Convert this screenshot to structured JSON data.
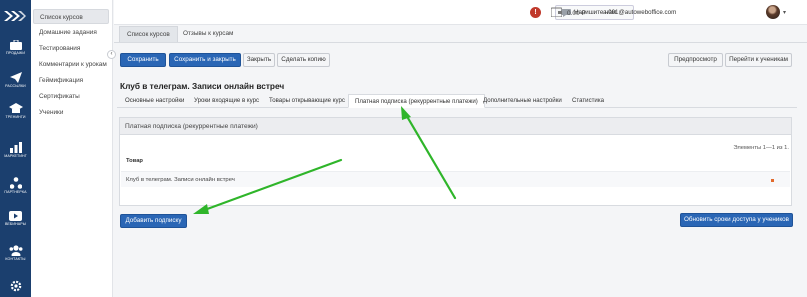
{
  "rail": {
    "items": [
      {
        "label": "ПРОДАЖИ",
        "icon": "briefcase-icon"
      },
      {
        "label": "РАССЫЛКИ",
        "icon": "paper-plane-icon"
      },
      {
        "label": "ТРЕНИНГИ",
        "icon": "graduation-cap-icon"
      },
      {
        "label": "МАРКЕТИНГ",
        "icon": "bar-chart-icon"
      },
      {
        "label": "ПАРТНЕРКА",
        "icon": "network-icon"
      },
      {
        "label": "ВЕБИНАРЫ",
        "icon": "video-play-icon"
      },
      {
        "label": "КОНТАКТЫ",
        "icon": "users-icon"
      },
      {
        "label": "",
        "icon": "gear-icon"
      }
    ]
  },
  "submenu": {
    "items": [
      "Список курсов",
      "Домашние задания",
      "Тестирования",
      "Комментарии к урокам",
      "Геймификация",
      "Сертификаты",
      "Ученики"
    ]
  },
  "header": {
    "write_us": "Напишите нам",
    "alert": "!",
    "balance": "0.00 ₽",
    "email": "a.001@autowebоffice.com",
    "caret": "▾"
  },
  "module_tabs": [
    "Список курсов",
    "Отзывы к курсам"
  ],
  "toolbar": {
    "save": "Сохранить",
    "save_close": "Сохранить и закрыть",
    "close": "Закрыть",
    "copy": "Сделать копию",
    "preview": "Предпросмотр",
    "go_students": "Перейти к ученикам"
  },
  "page_title": "Клуб в телеграм. Записи онлайн встреч",
  "form_tabs": [
    "Основные настройки",
    "Уроки входящие в курс",
    "Товары открывающие курс",
    "Платная подписка (рекуррентные платежи)",
    "Дополнительные настройки",
    "Статистика"
  ],
  "panel": {
    "title": "Платная подписка (рекуррентные платежи)",
    "count": "Элементы 1—1 из 1.",
    "column_product": "Товар",
    "row_product": "Клуб в телеграм. Записи онлайн встреч"
  },
  "actions": {
    "add_subscription": "Добавить подписку",
    "update_access": "Обновить сроки доступа у учеников"
  },
  "colors": {
    "rail": "#1b3f6e",
    "primary": "#2a66b5",
    "arrow": "#2fb52a",
    "alert": "#c0392b"
  }
}
